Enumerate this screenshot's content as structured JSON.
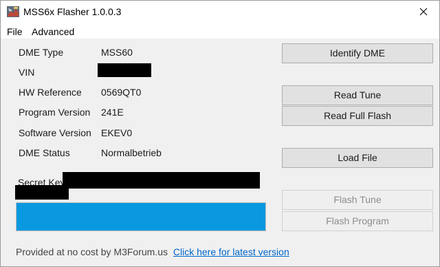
{
  "window": {
    "title": "MSS6x Flasher 1.0.0.3",
    "icon": "app-logo-icon",
    "close_icon": "close-icon"
  },
  "menu": {
    "items": [
      {
        "label": "File"
      },
      {
        "label": "Advanced"
      }
    ]
  },
  "info": {
    "dme_type_label": "DME Type",
    "dme_type_value": "MSS60",
    "vin_label": "VIN",
    "hw_reference_label": "HW Reference",
    "hw_reference_value": "0569QT0",
    "program_version_label": "Program Version",
    "program_version_value": "241E",
    "software_version_label": "Software Version",
    "software_version_value": "EKEV0",
    "dme_status_label": "DME Status",
    "dme_status_value": "Normalbetrieb",
    "secret_key_label": "Secret Key:"
  },
  "buttons": {
    "identify_dme": "Identify DME",
    "read_tune": "Read Tune",
    "read_full_flash": "Read Full Flash",
    "load_file": "Load File",
    "flash_tune": "Flash Tune",
    "flash_program": "Flash Program"
  },
  "progress": {
    "value_fraction": 1.0,
    "color": "#0a99e0"
  },
  "footer": {
    "text": "Provided at no cost by M3Forum.us",
    "link_text": "Click here for latest version",
    "link_color": "#0066cc"
  }
}
